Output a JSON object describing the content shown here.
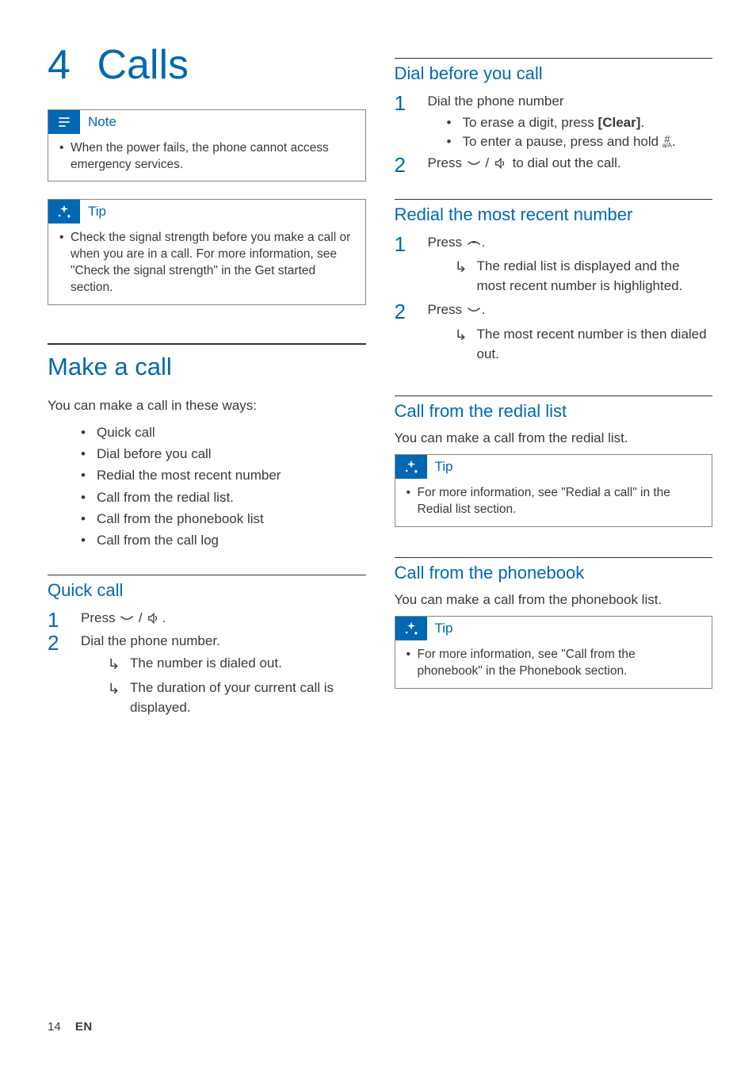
{
  "chapter": {
    "number": "4",
    "title": "Calls"
  },
  "noteBox": {
    "label": "Note",
    "items": [
      "When the power fails, the phone cannot access emergency services."
    ]
  },
  "tipBox1": {
    "label": "Tip",
    "items": [
      "Check the signal strength before you make a call or when you are in a call. For more information, see \"Check the signal strength\" in the Get started section."
    ]
  },
  "makeCall": {
    "title": "Make a call",
    "intro": "You can make a call in these ways:",
    "ways": [
      "Quick call",
      "Dial before you call",
      "Redial the most recent number",
      "Call from the redial list.",
      "Call from the phonebook list",
      "Call from the call log"
    ]
  },
  "quickCall": {
    "title": "Quick call",
    "step1_a": "Press ",
    "step1_b": " / ",
    "step1_c": ".",
    "step2": "Dial the phone number.",
    "result1": "The number is dialed out.",
    "result2": "The duration of your current call is displayed."
  },
  "dialBefore": {
    "title": "Dial before you call",
    "step1": "Dial the phone number",
    "sub1_a": "To erase a digit, press ",
    "sub1_key": "[Clear]",
    "sub1_b": ".",
    "sub2_a": "To enter a pause, press and hold ",
    "sub2_b": ".",
    "step2_a": "Press ",
    "step2_b": " / ",
    "step2_c": " to dial out the call."
  },
  "redialRecent": {
    "title": "Redial the most recent number",
    "step1_a": "Press ",
    "step1_b": ".",
    "result1": "The redial list is displayed and the most recent number is highlighted.",
    "step2_a": "Press ",
    "step2_b": ".",
    "result2": "The most recent number is then dialed out."
  },
  "fromRedial": {
    "title": "Call from the redial list",
    "intro": "You can make a call from the redial list."
  },
  "tipBox2": {
    "label": "Tip",
    "items": [
      "For more information, see \"Redial a call\" in the Redial list section."
    ]
  },
  "fromPhonebook": {
    "title": "Call from the phonebook",
    "intro": "You can make a call from the phonebook list."
  },
  "tipBox3": {
    "label": "Tip",
    "items": [
      "For more information, see \"Call from the phonebook\" in the Phonebook section."
    ]
  },
  "footer": {
    "page": "14",
    "lang": "EN"
  }
}
